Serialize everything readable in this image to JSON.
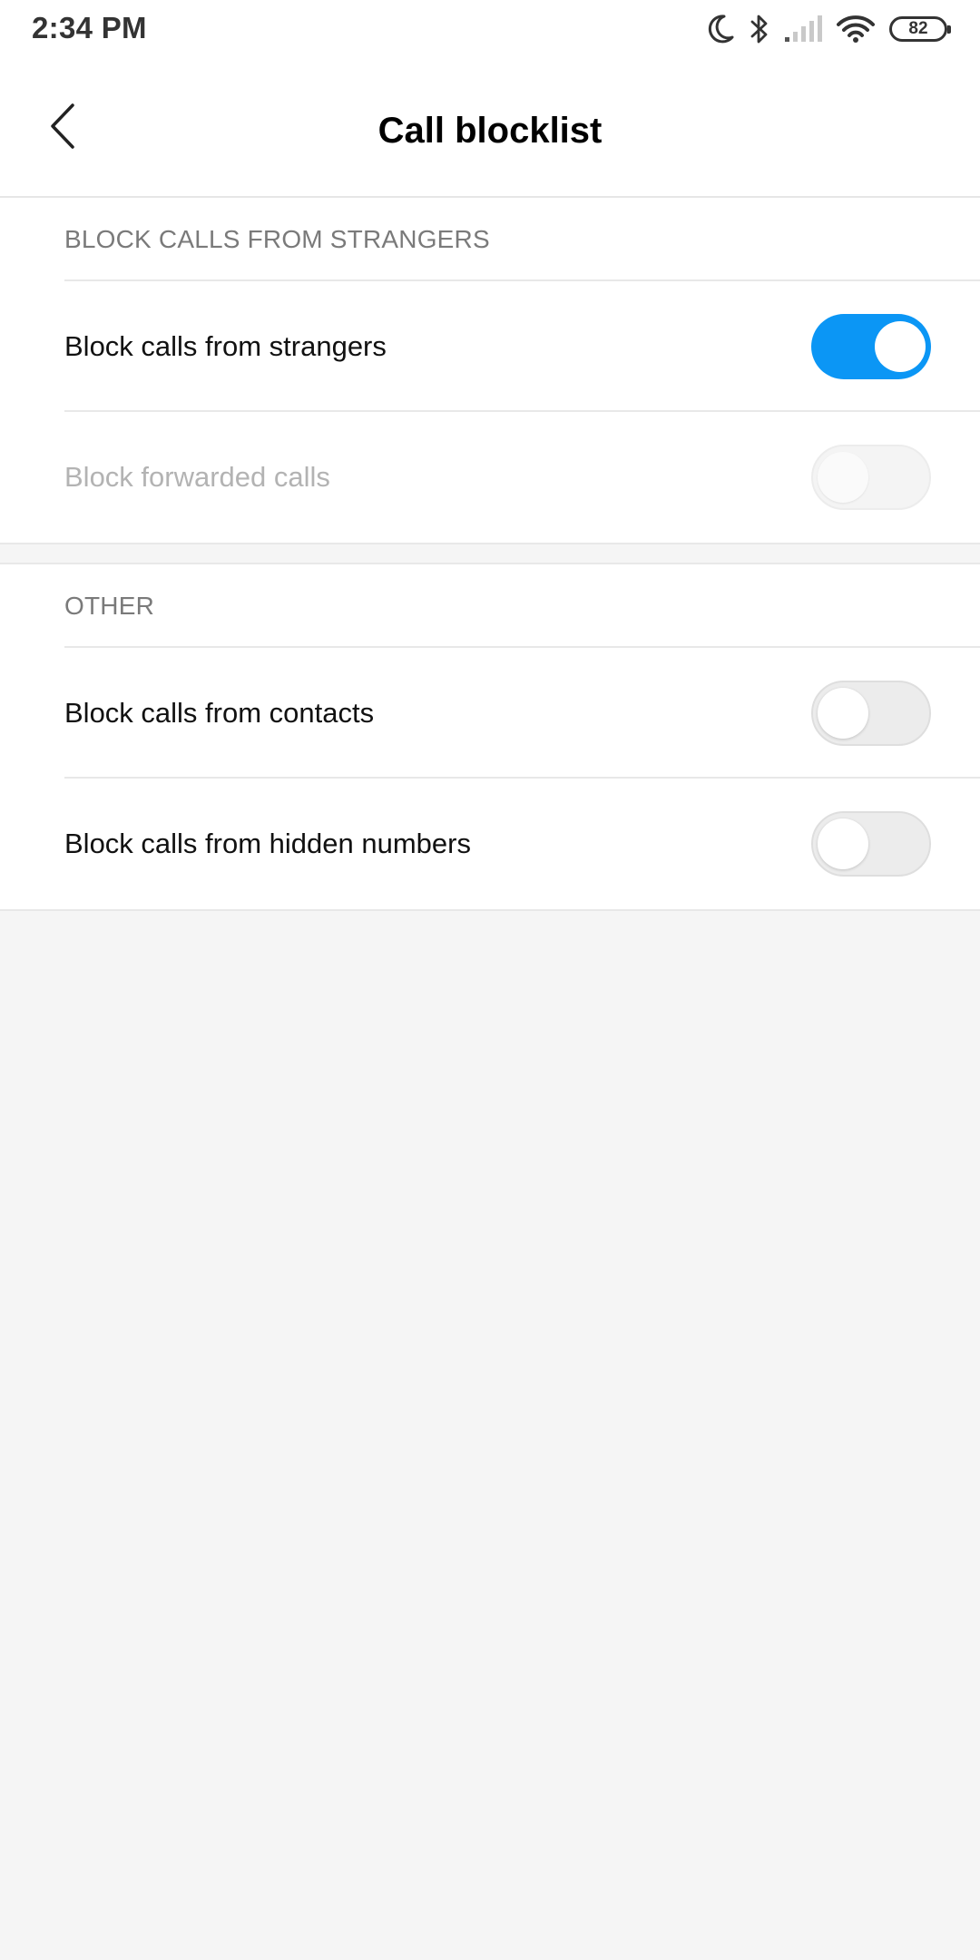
{
  "status_bar": {
    "time": "2:34 PM",
    "battery_level": "82",
    "icons": [
      "moon-icon",
      "bluetooth-icon",
      "signal-icon",
      "wifi-icon",
      "battery-icon"
    ]
  },
  "header": {
    "title": "Call blocklist",
    "back_icon": "chevron-left-icon"
  },
  "sections": [
    {
      "title": "BLOCK CALLS FROM STRANGERS",
      "rows": [
        {
          "label": "Block calls from strangers",
          "toggle": "on",
          "enabled": true
        },
        {
          "label": "Block forwarded calls",
          "toggle": "off",
          "enabled": false
        }
      ]
    },
    {
      "title": "OTHER",
      "rows": [
        {
          "label": "Block calls from contacts",
          "toggle": "off",
          "enabled": true
        },
        {
          "label": "Block calls from hidden numbers",
          "toggle": "off",
          "enabled": true
        }
      ]
    }
  ],
  "colors": {
    "accent": "#0b96f5",
    "background": "#f5f5f5",
    "surface": "#ffffff",
    "section_title": "#7a7a7a",
    "disabled_text": "#b3b3b3"
  }
}
